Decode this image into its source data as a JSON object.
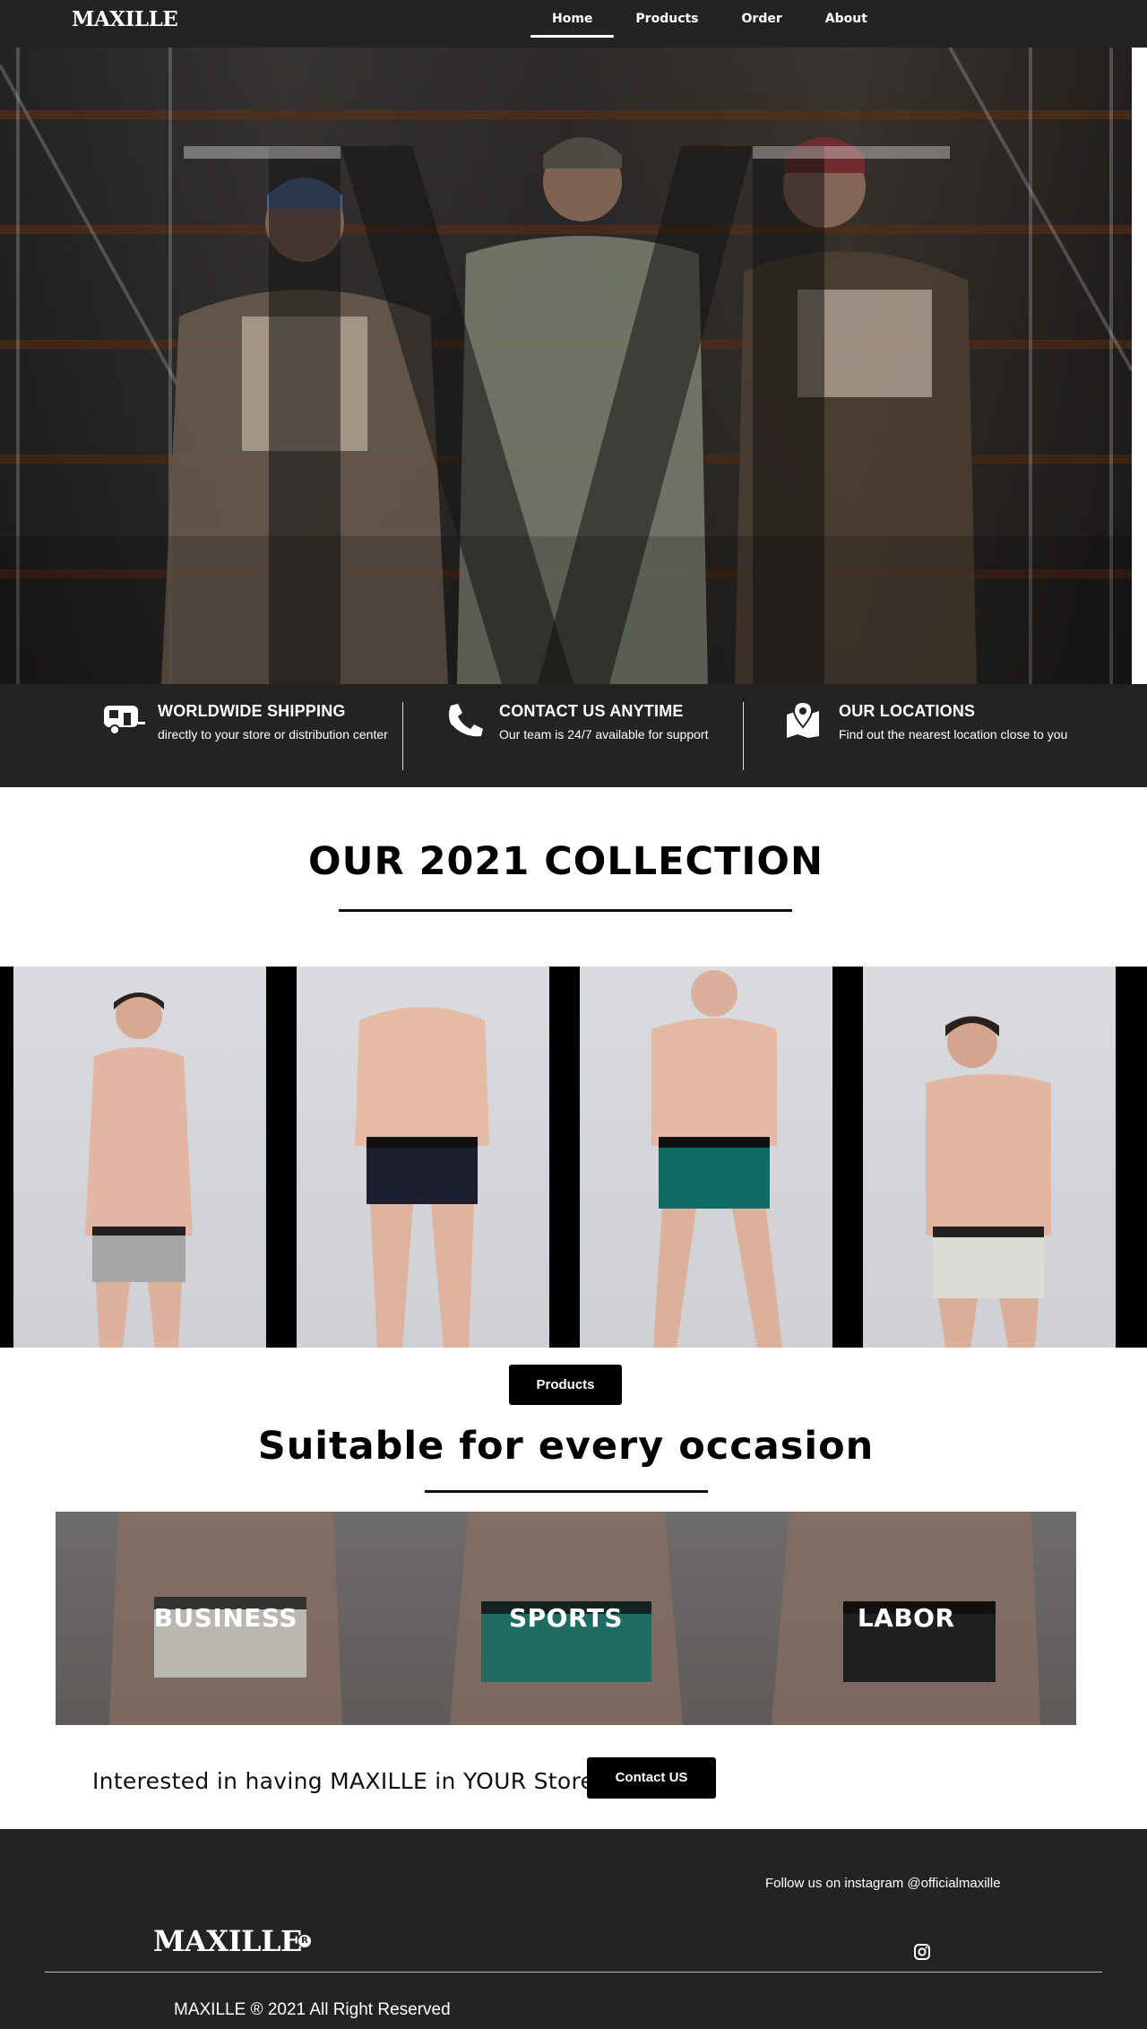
{
  "nav": {
    "logo": "MAXILLE",
    "links": [
      {
        "label": "Home",
        "active": true
      },
      {
        "label": "Products",
        "active": false
      },
      {
        "label": "Order",
        "active": false
      },
      {
        "label": "About",
        "active": false
      }
    ]
  },
  "features": [
    {
      "icon": "camper-trailer-icon",
      "title": "WORLDWIDE SHIPPING",
      "text": "directly to your store or distribution center"
    },
    {
      "icon": "phone-icon",
      "title": "CONTACT US ANYTIME",
      "text": "Our team is 24/7 available for support"
    },
    {
      "icon": "map-location-icon",
      "title": "OUR LOCATIONS",
      "text": "Find out the nearest location close to you"
    }
  ],
  "collection": {
    "title": "OUR 2021 COLLECTION",
    "products_button": "Products",
    "items": [
      {
        "color": "#a8a5a6"
      },
      {
        "color": "#1b1f2e"
      },
      {
        "color": "#0f6b63"
      },
      {
        "color": "#dcdcd6"
      }
    ]
  },
  "occasions": {
    "title": "Suitable for every occasion",
    "items": [
      {
        "label": "BUSINESS",
        "color": "#c9c9c4"
      },
      {
        "label": "SPORTS",
        "color": "#0f6b63"
      },
      {
        "label": "LABOR",
        "color": "#15171c"
      }
    ]
  },
  "cta": {
    "text": "Interested in having MAXILLE in YOUR Store?",
    "button": "Contact US"
  },
  "footer": {
    "follow": "Follow us on instagram @officialmaxille",
    "logo": "MAXILLE",
    "reg_mark": "R",
    "copyright": "MAXILLE ® 2021 All Right Reserved"
  }
}
